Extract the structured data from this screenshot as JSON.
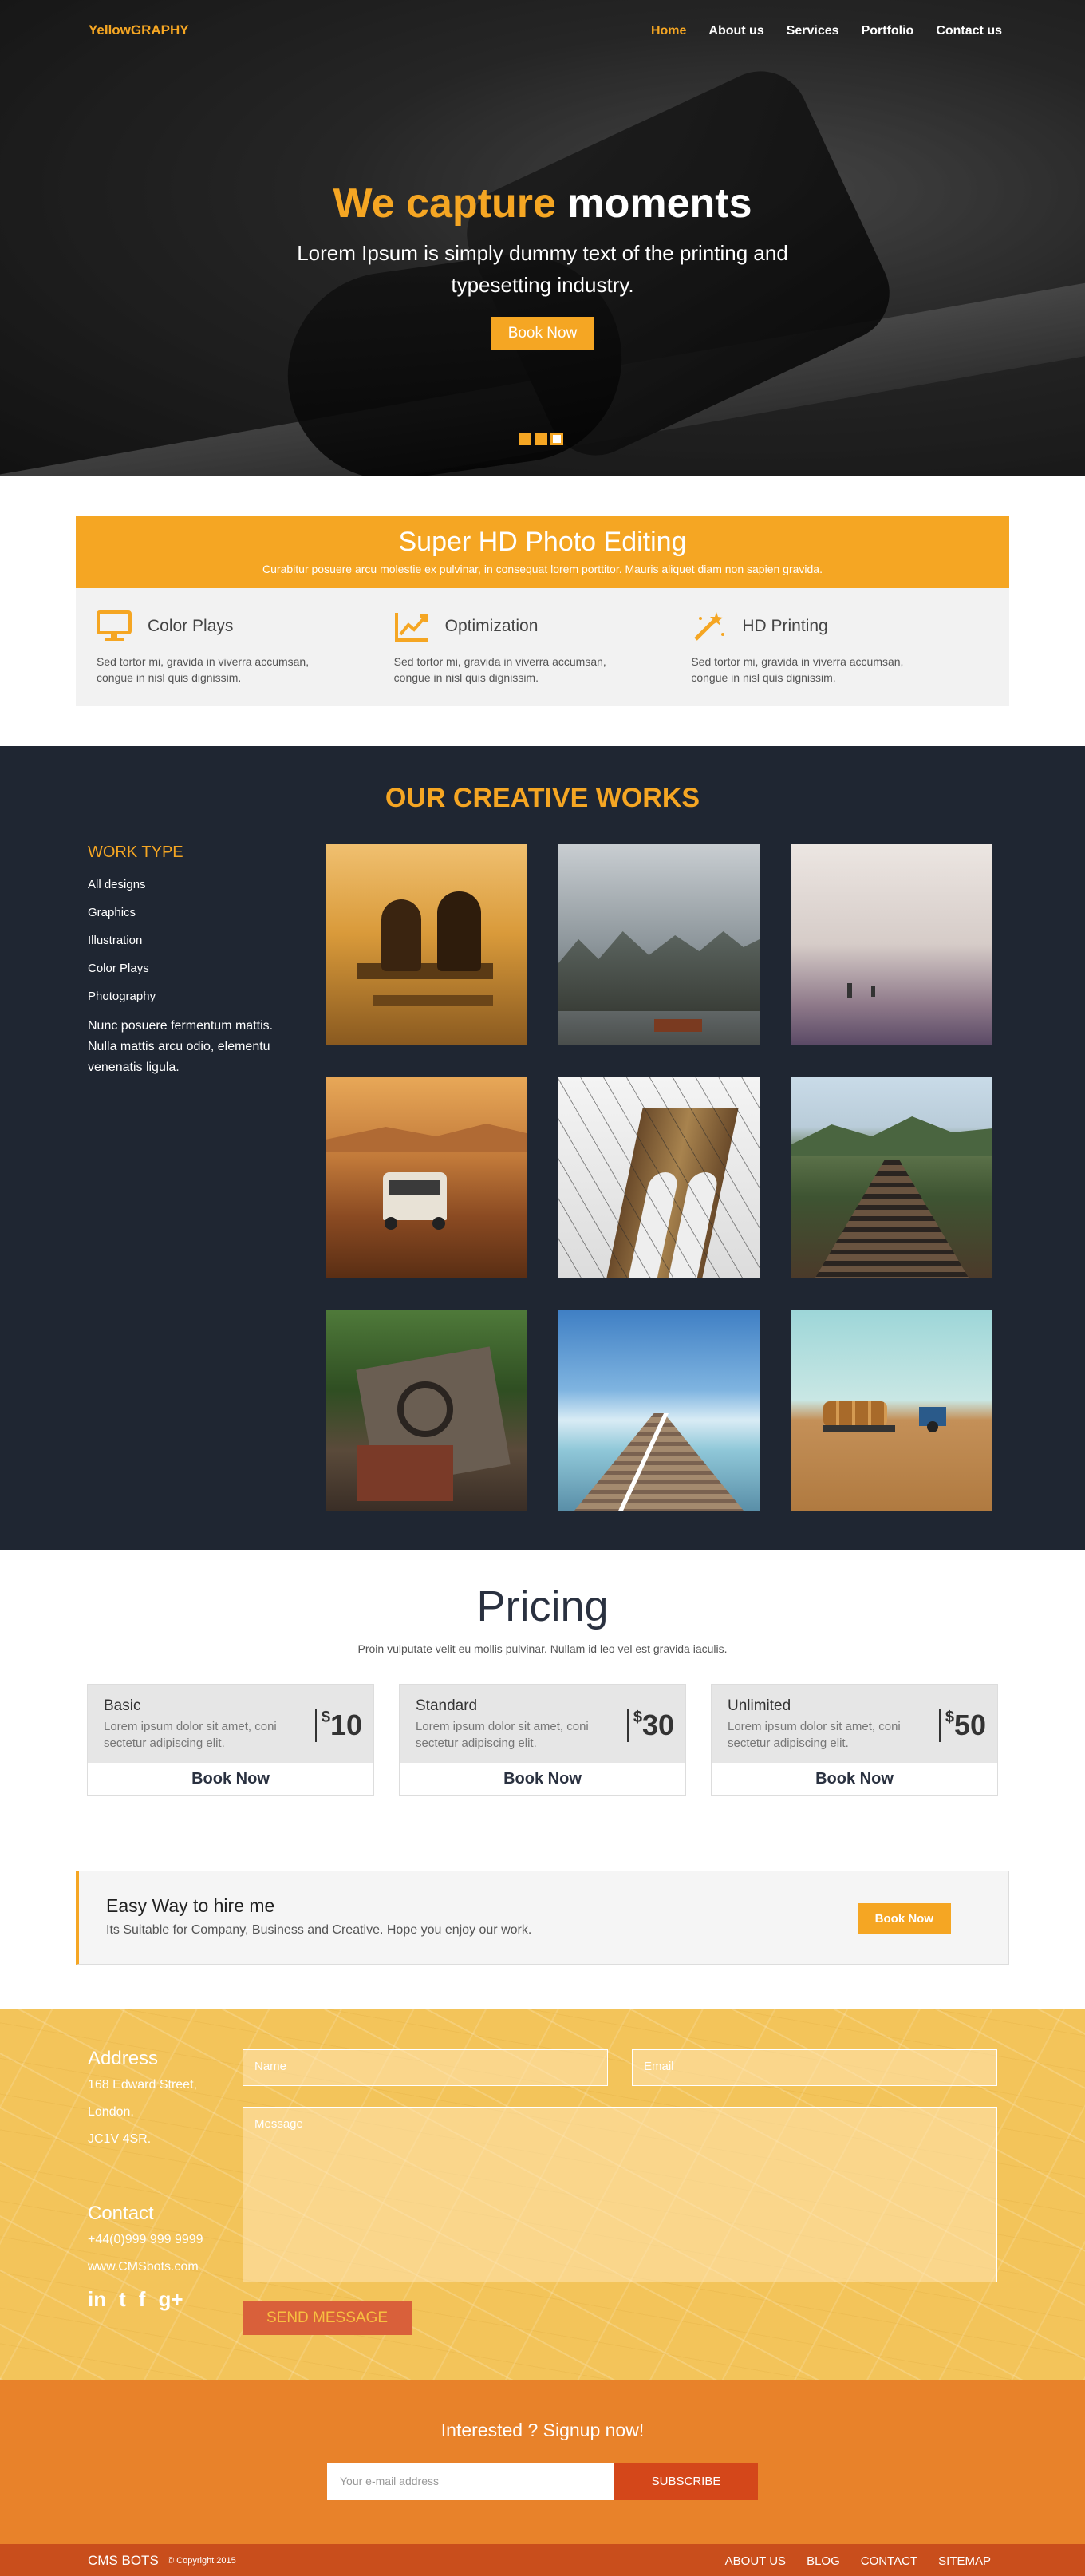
{
  "header": {
    "logo": "YellowGRAPHY",
    "nav": [
      "Home",
      "About us",
      "Services",
      "Portfolio",
      "Contact us"
    ]
  },
  "hero": {
    "title_accent": "We capture",
    "title_rest": "moments",
    "subtitle": "Lorem Ipsum is simply dummy text of the printing and typesetting industry.",
    "button": "Book Now"
  },
  "features": {
    "title": "Super HD Photo Editing",
    "subtitle": "Curabitur posuere arcu molestie ex pulvinar, in consequat lorem porttitor. Mauris aliquet diam non sapien gravida.",
    "items": [
      {
        "name": "Color Plays",
        "icon": "monitor-icon",
        "desc": "Sed tortor mi, gravida in viverra accumsan, congue in nisl quis dignissim."
      },
      {
        "name": "Optimization",
        "icon": "chart-icon",
        "desc": "Sed tortor mi, gravida in viverra accumsan, congue in nisl quis dignissim."
      },
      {
        "name": "HD Printing",
        "icon": "magic-wand-icon",
        "desc": "Sed tortor mi, gravida in viverra accumsan, congue in nisl quis dignissim."
      }
    ]
  },
  "works": {
    "title": "OUR CREATIVE WORKS",
    "work_type": "WORK TYPE",
    "filters": [
      "All designs",
      "Graphics",
      "Illustration",
      "Color Plays",
      "Photography"
    ],
    "blurb": "Nunc posuere fermentum mattis. Nulla mattis arcu odio, elementu venenatis ligula."
  },
  "pricing": {
    "title": "Pricing",
    "subtitle": "Proin vulputate velit eu mollis pulvinar. Nullam id leo vel est gravida iaculis.",
    "plans": [
      {
        "name": "Basic",
        "desc": "Lorem ipsum dolor sit amet, coni sectetur adipiscing elit.",
        "currency": "$",
        "price": "10",
        "button": "Book Now"
      },
      {
        "name": "Standard",
        "desc": "Lorem ipsum dolor sit amet, coni sectetur adipiscing elit.",
        "currency": "$",
        "price": "30",
        "button": "Book Now"
      },
      {
        "name": "Unlimited",
        "desc": "Lorem ipsum dolor sit amet, coni sectetur adipiscing elit.",
        "currency": "$",
        "price": "50",
        "button": "Book Now"
      }
    ]
  },
  "hire": {
    "title": "Easy Way to hire me",
    "subtitle": "Its Suitable for Company, Business and Creative. Hope you enjoy our work.",
    "button": "Book Now"
  },
  "contact": {
    "address_heading": "Address",
    "address_lines": [
      "168 Edward Street,",
      "London,",
      "JC1V 4SR."
    ],
    "contact_heading": "Contact",
    "phone": "+44(0)999 999 9999",
    "web": "www.CMSbots.com",
    "social": [
      "in",
      "t",
      "f",
      "g+"
    ],
    "name_placeholder": "Name",
    "email_placeholder": "Email",
    "message_placeholder": "Message",
    "send_button": "SEND MESSAGE"
  },
  "signup": {
    "title": "Interested ? Signup now!",
    "placeholder": "Your e-mail address",
    "button": "SUBSCRIBE"
  },
  "footer": {
    "brand": "CMS BOTS",
    "copyright": "© Copyright 2015",
    "links": [
      "ABOUT US",
      "BLOG",
      "CONTACT",
      "SITEMAP"
    ]
  }
}
